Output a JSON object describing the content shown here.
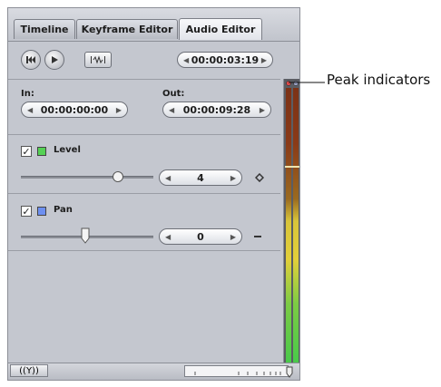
{
  "tabs": [
    {
      "label": "Timeline"
    },
    {
      "label": "Keyframe Editor"
    },
    {
      "label": "Audio Editor",
      "active": true
    }
  ],
  "transport": {
    "timecode": "00:00:03:19"
  },
  "inout": {
    "in_label": "In:",
    "in_value": "00:00:00:00",
    "out_label": "Out:",
    "out_value": "00:00:09:28"
  },
  "level": {
    "label": "Level",
    "checked": true,
    "value": "4",
    "swatch_color": "#55d155"
  },
  "pan": {
    "label": "Pan",
    "checked": true,
    "value": "0",
    "swatch_color": "#6d8ff0"
  },
  "callout": {
    "text": "Peak indicators"
  },
  "footer": {
    "left_icon": "((Y))"
  },
  "colors": {
    "panel_bg": "#c4c7cf",
    "meter_green": "#46c94a",
    "meter_yellow": "#e2cf3a",
    "meter_dark": "#7a2a1a"
  }
}
